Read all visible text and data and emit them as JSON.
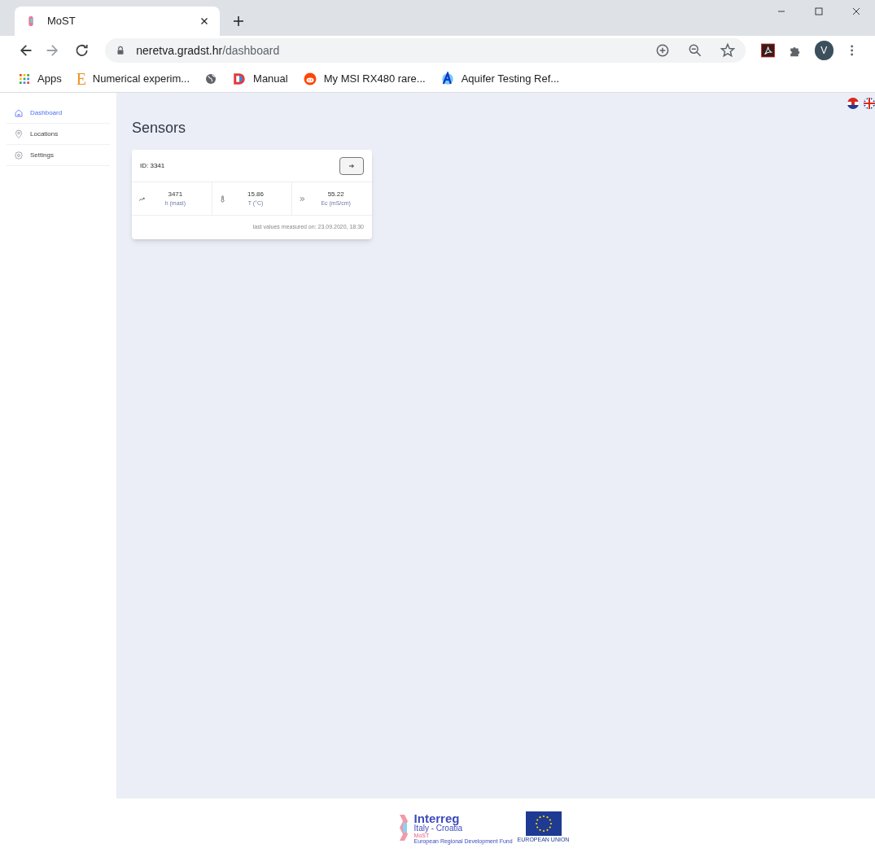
{
  "browser": {
    "tab_title": "MoST",
    "url_host": "neretva.gradst.hr",
    "url_path": "/dashboard",
    "profile_initial": "V",
    "bookmarks": [
      {
        "kind": "apps",
        "label": "Apps"
      },
      {
        "kind": "letter",
        "icon_char": "E",
        "label": "Numerical experim..."
      },
      {
        "kind": "globe"
      },
      {
        "kind": "d-logo",
        "label": "Manual"
      },
      {
        "kind": "reddit",
        "label": "My MSI RX480 rare..."
      },
      {
        "kind": "a-logo",
        "label": "Aquifer Testing Ref..."
      }
    ]
  },
  "sidebar": {
    "items": [
      {
        "kind": "home",
        "label": "Dashboard",
        "selected": true
      },
      {
        "kind": "pin",
        "label": "Locations",
        "selected": false
      },
      {
        "kind": "gear",
        "label": "Settings",
        "selected": false
      }
    ]
  },
  "page_title": "Sensors",
  "sensors": [
    {
      "id": "ID: 3341",
      "readings": [
        {
          "kind": "trend",
          "value": "3471",
          "unit": "h (masl)"
        },
        {
          "kind": "thermometer",
          "value": "15.86",
          "unit": "T (°C)"
        },
        {
          "kind": "chevrons",
          "value": "55.22",
          "unit": "Ec (mS/cm)"
        }
      ],
      "footer": "last values measured on: 23.09.2020, 18:30"
    }
  ],
  "footer_logo": {
    "title": "Interreg",
    "subtitle": "Italy - Croatia",
    "project": "MoST",
    "fund": "European Regional Development Fund",
    "eu_label": "EUROPEAN UNION"
  }
}
